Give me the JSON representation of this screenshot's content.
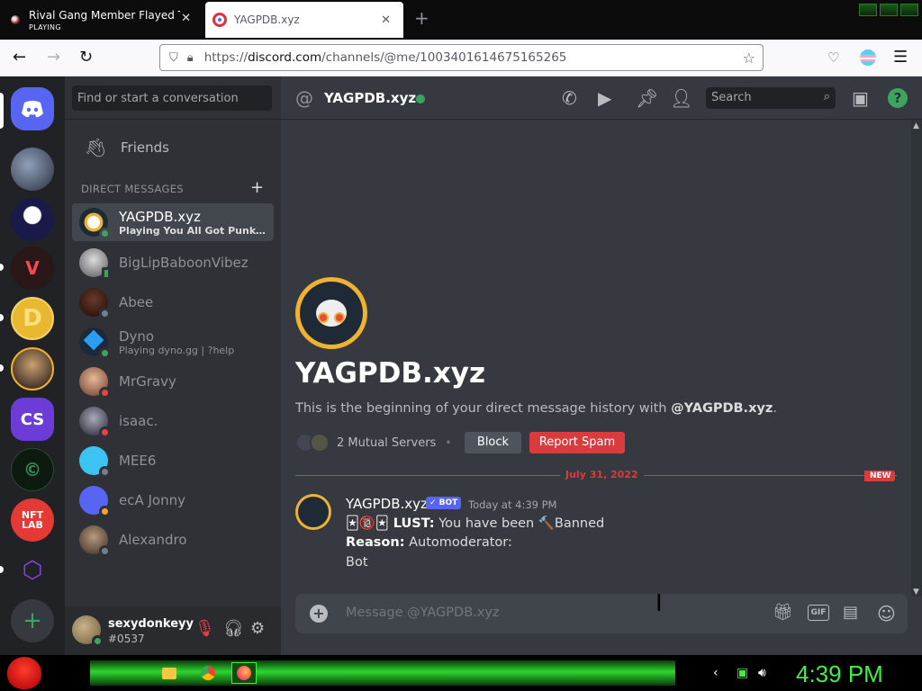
{
  "browser": {
    "tabs": [
      {
        "title": "Rival Gang Member Flayed Tort",
        "subtitle": "PLAYING"
      },
      {
        "title": "YAGPDB.xyz"
      }
    ],
    "url_prefix": "https://",
    "url_host": "discord.com",
    "url_path": "/channels/@me/1003401614675165265"
  },
  "sidebar": {
    "search_placeholder": "Find or start a conversation",
    "friends_label": "Friends",
    "dm_header": "DIRECT MESSAGES",
    "dms": [
      {
        "name": "YAGPDB.xyz",
        "activity": "Playing You All Got Punked Du...",
        "status": "online",
        "active": true
      },
      {
        "name": "BigLipBaboonVibez",
        "activity": "",
        "status": "mobile"
      },
      {
        "name": "Abee",
        "activity": "",
        "status": "offline"
      },
      {
        "name": "Dyno",
        "activity": "Playing dyno.gg | ?help",
        "status": "online"
      },
      {
        "name": "MrGravy",
        "activity": "",
        "status": "dnd"
      },
      {
        "name": "isaac.",
        "activity": "",
        "status": "dnd"
      },
      {
        "name": "MEE6",
        "activity": "",
        "status": "offline"
      },
      {
        "name": "ecA Jonny",
        "activity": "",
        "status": "idle"
      },
      {
        "name": "Alexandro",
        "activity": "",
        "status": "offline"
      }
    ],
    "user": {
      "name": "sexydonkeyy",
      "tag": "#0537"
    }
  },
  "header": {
    "channel_name": "YAGPDB.xyz",
    "search_placeholder": "Search"
  },
  "welcome": {
    "title": "YAGPDB.xyz",
    "subtitle_prefix": "This is the beginning of your direct message history with ",
    "subtitle_user": "@YAGPDB.xyz",
    "subtitle_suffix": ".",
    "mutual": "2 Mutual Servers",
    "block_label": "Block",
    "report_label": "Report Spam"
  },
  "divider": {
    "date": "July 31, 2022",
    "badge": "NEW"
  },
  "message": {
    "author": "YAGPDB.xyz",
    "bot_tag": "✓ BOT",
    "timestamp": "Today at 4:39 PM",
    "line1_bold": "🃏🔞🃏 LUST:",
    "line1_text": "You have been 🔨Banned",
    "line2_bold": "Reason:",
    "line2_text": "Automoderator:",
    "line3_text": "Bot"
  },
  "composer": {
    "placeholder": "Message @YAGPDB.xyz",
    "gif_label": "GIF"
  },
  "taskbar": {
    "clock": "4:39 PM"
  },
  "colors": {
    "blurple": "#5865f2",
    "online": "#3ba55d",
    "danger": "#d83c3e",
    "clock_green": "#3ff13f"
  }
}
